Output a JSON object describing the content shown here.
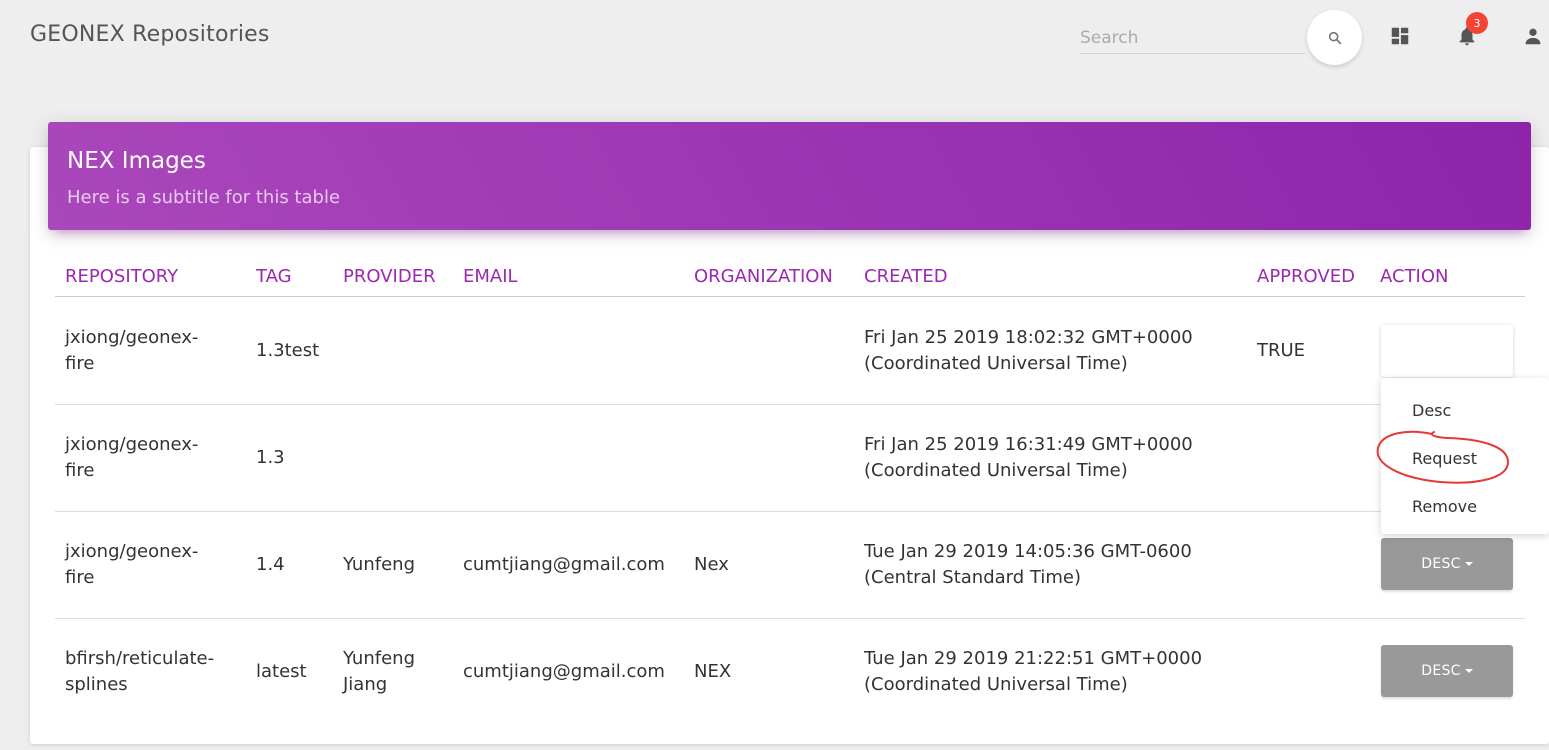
{
  "header": {
    "brand": "GEONEX Repositories",
    "search_placeholder": "Search",
    "notification_count": "3",
    "icons": [
      "search-icon",
      "dashboard-icon",
      "bell-icon",
      "person-icon"
    ]
  },
  "card": {
    "title": "NEX Images",
    "subtitle": "Here is a subtitle for this table",
    "accent_color": "#9c27b0"
  },
  "table": {
    "columns": [
      "REPOSITORY",
      "TAG",
      "PROVIDER",
      "EMAIL",
      "ORGANIZATION",
      "CREATED",
      "APPROVED",
      "ACTION"
    ],
    "rows": [
      {
        "repository": [
          "jxiong/geonex-",
          "fire"
        ],
        "tag": "1.3test",
        "provider": [],
        "email": "",
        "organization": "",
        "created": [
          "Fri Jan 25 2019 18:02:32 GMT+0000",
          "(Coordinated Universal Time)"
        ],
        "approved": "TRUE",
        "action": ""
      },
      {
        "repository": [
          "jxiong/geonex-",
          "fire"
        ],
        "tag": "1.3",
        "provider": [],
        "email": "",
        "organization": "",
        "created": [
          "Fri Jan 25 2019 16:31:49 GMT+0000",
          "(Coordinated Universal Time)"
        ],
        "approved": "",
        "action": ""
      },
      {
        "repository": [
          "jxiong/geonex-",
          "fire"
        ],
        "tag": "1.4",
        "provider": [
          "Yunfeng"
        ],
        "email": "cumtjiang@gmail.com",
        "organization": "Nex",
        "created": [
          "Tue Jan 29 2019 14:05:36 GMT-0600",
          "(Central Standard Time)"
        ],
        "approved": "",
        "action": "DESC"
      },
      {
        "repository": [
          "bfirsh/reticulate-",
          "splines"
        ],
        "tag": "latest",
        "provider": [
          "Yunfeng",
          "Jiang"
        ],
        "email": "cumtjiang@gmail.com",
        "organization": "NEX",
        "created": [
          "Tue Jan 29 2019 21:22:51 GMT+0000",
          "(Coordinated Universal Time)"
        ],
        "approved": "",
        "action": "DESC"
      }
    ]
  },
  "dropdown": {
    "items": [
      "Desc",
      "Request",
      "Remove"
    ]
  },
  "annotation_color": "#e53935"
}
